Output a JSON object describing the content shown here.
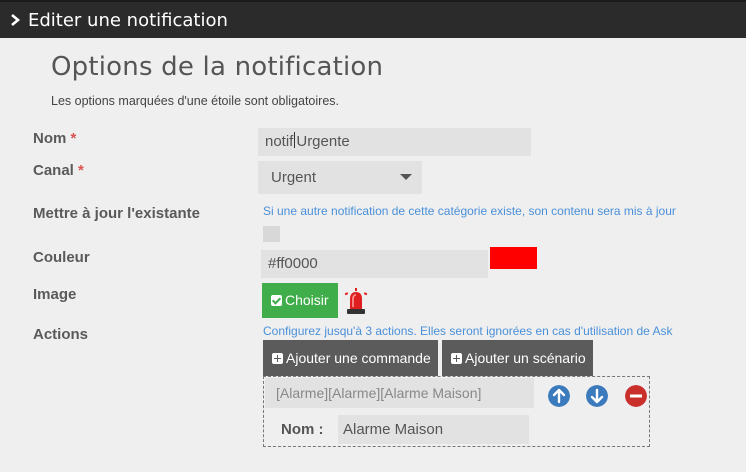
{
  "header": {
    "title": "Editer une notification"
  },
  "section": {
    "title": "Options de la notification",
    "subtitle": "Les options marquées d'une étoile sont obligatoires."
  },
  "fields": {
    "nom": {
      "label": "Nom",
      "required_mark": "*",
      "value_before_caret": "notif",
      "value_after_caret": "Urgente"
    },
    "canal": {
      "label": "Canal",
      "required_mark": "*",
      "selected": "Urgent"
    },
    "mettre_a_jour": {
      "label": "Mettre à jour l'existante",
      "help": "Si une autre notification de cette catégorie existe, son contenu sera mis à jour",
      "checked": false
    },
    "couleur": {
      "label": "Couleur",
      "value": "#ff0000",
      "swatch_color": "#ff0000"
    },
    "image": {
      "label": "Image",
      "button_label": "Choisir",
      "icon": "siren-icon"
    },
    "actions": {
      "label": "Actions",
      "help": "Configurez jusqu'à 3 actions. Elles seront ignorées en cas d'utilisation de Ask",
      "add_command_label": "Ajouter une commande",
      "add_scenario_label": "Ajouter un scénario",
      "items": [
        {
          "command": "[Alarme][Alarme][Alarme Maison]",
          "name_label": "Nom :",
          "name_value": "Alarme Maison"
        }
      ]
    }
  },
  "colors": {
    "header_bg": "#2b2b2b",
    "required": "#d9534f",
    "help_link": "#4a90d9",
    "green_button": "#3fad4a",
    "dark_button": "#5b5b5b",
    "move_button": "#3a7abd",
    "remove_button": "#c9302c"
  }
}
